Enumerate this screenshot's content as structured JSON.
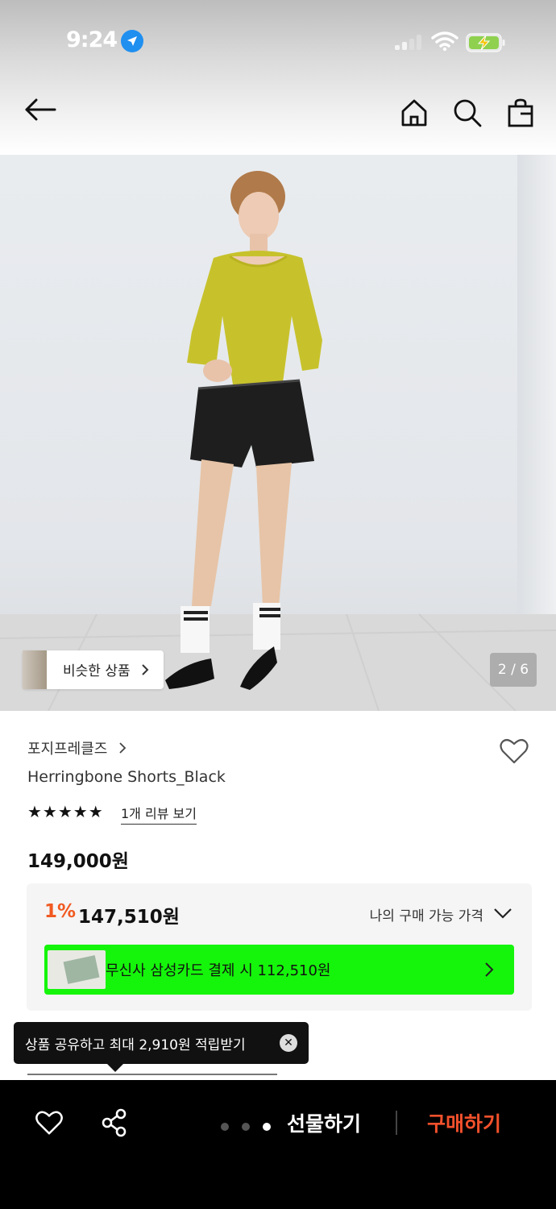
{
  "status_bar": {
    "time": "9:24"
  },
  "product": {
    "image_counter": "2 / 6",
    "similar_label": "비슷한 상품",
    "brand": "포지프레클즈",
    "name": "Herringbone Shorts_Black",
    "stars": "★★★★★",
    "rating": 5,
    "review_link": "1개 리뷰 보기",
    "price": "149,000원"
  },
  "price_box": {
    "discount_rate": "1%",
    "discount_price": "147,510원",
    "my_price_label": "나의 구매 가능 가격",
    "card_promo": "무신사 삼성카드 결제 시 112,510원"
  },
  "tooltip": {
    "text": "상품 공유하고 최대 2,910원 적립받기"
  },
  "bottom_bar": {
    "gift_label": "선물하기",
    "buy_label": "구매하기"
  },
  "colors": {
    "accent_orange": "#f15a22",
    "buy_red": "#f2512c",
    "card_green": "#15f50b",
    "bottom_bg": "#000000"
  },
  "icons": [
    "back-arrow-icon",
    "home-icon",
    "search-icon",
    "shopping-bag-icon",
    "heart-icon",
    "share-icon",
    "chevron-down-icon",
    "chevron-right-icon",
    "close-icon"
  ]
}
